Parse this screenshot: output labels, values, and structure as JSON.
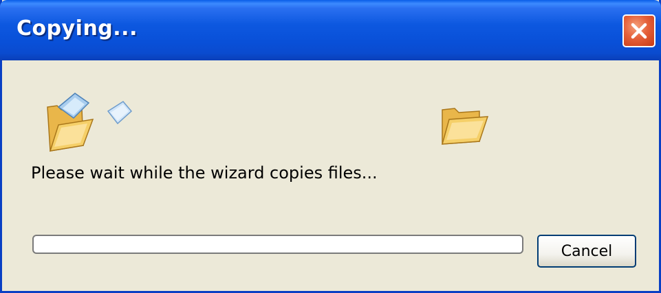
{
  "window": {
    "title": "Copying...",
    "close_icon": "close-x-icon"
  },
  "body": {
    "source_icon": "open-folder-with-flying-page-icon",
    "dest_icon": "folder-icon",
    "message": "Please wait while the wizard copies files...",
    "progress_percent": 0,
    "cancel_label": "Cancel"
  },
  "colors": {
    "titlebar": "#0a50d8",
    "window_bg": "#ece9d8",
    "close_button": "#e5603a",
    "button_border": "#003c74"
  }
}
